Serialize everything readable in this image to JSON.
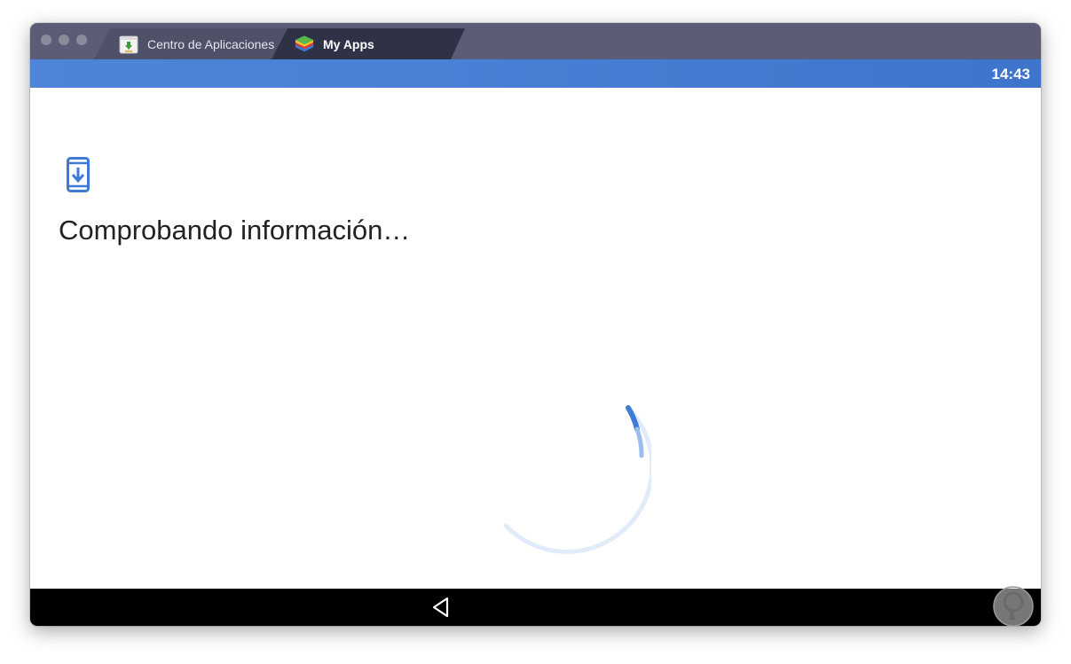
{
  "window": {
    "tabs": [
      {
        "label": "Centro de Aplicaciones",
        "icon": "app-center-icon",
        "active": false
      },
      {
        "label": "My Apps",
        "icon": "bluestacks-layers-icon",
        "active": true
      }
    ]
  },
  "statusbar": {
    "time": "14:43"
  },
  "main": {
    "icon": "phone-download-icon",
    "title": "Comprobando información…",
    "loading_icon": "loading-spinner"
  },
  "navbar": {
    "back_icon": "back-triangle-icon",
    "watermark_icon": "solvetic-logo-icon"
  },
  "colors": {
    "accent_blue": "#4a80d6",
    "titlebar": "#5a5d75",
    "active_tab": "#2f3247"
  }
}
